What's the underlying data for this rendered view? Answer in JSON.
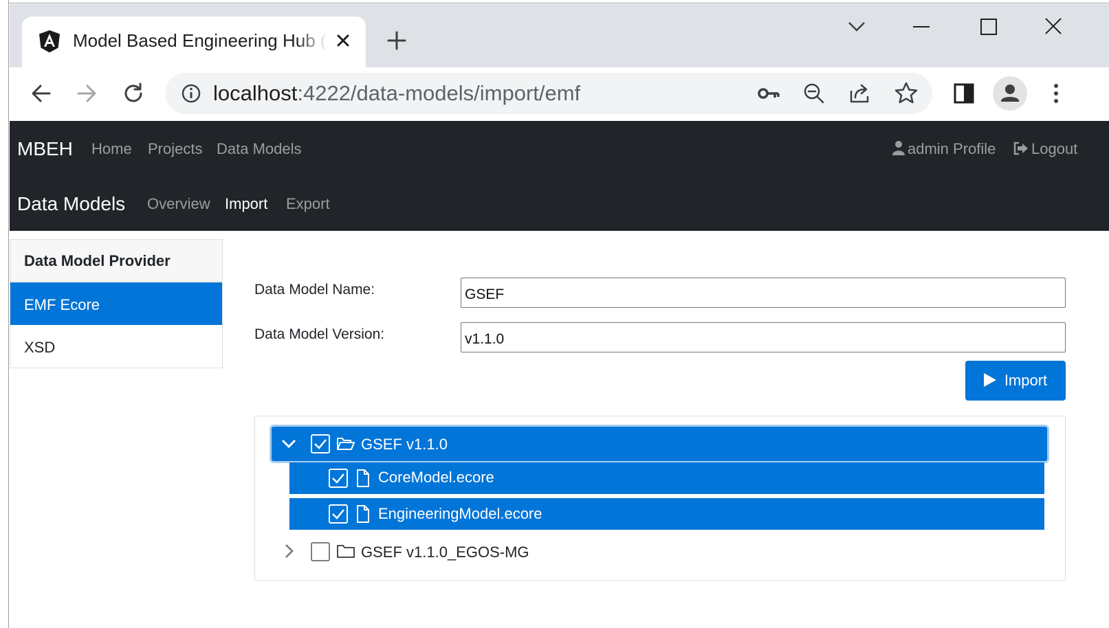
{
  "browser": {
    "tab_title": "Model Based Engineering Hub (Model Based Engineering Hub)",
    "url_host": "localhost",
    "url_path": ":4222/data-models/import/emf"
  },
  "navbar": {
    "brand": "MBEH",
    "links": [
      "Home",
      "Projects",
      "Data Models"
    ],
    "profile": "admin Profile",
    "logout": "Logout"
  },
  "subnav": {
    "title": "Data Models",
    "links": [
      "Overview",
      "Import",
      "Export"
    ],
    "active": "Import"
  },
  "provider": {
    "header": "Data Model Provider",
    "items": [
      "EMF Ecore",
      "XSD"
    ],
    "selected": "EMF Ecore"
  },
  "form": {
    "name_label": "Data Model Name:",
    "name_value": "GSEF",
    "version_label": "Data Model Version:",
    "version_value": "v1.1.0",
    "import_label": "Import"
  },
  "tree": {
    "nodes": [
      {
        "label": "GSEF v1.1.0",
        "expanded": true,
        "checked": true,
        "selected": true,
        "type": "folder-open-icon"
      },
      {
        "label": "CoreModel.ecore",
        "checked": true,
        "selected": true,
        "type": "file-icon"
      },
      {
        "label": "EngineeringModel.ecore",
        "checked": true,
        "selected": true,
        "type": "file-icon"
      },
      {
        "label": "GSEF v1.1.0_EGOS-MG",
        "expanded": false,
        "checked": false,
        "selected": false,
        "type": "folder-icon"
      }
    ]
  },
  "colors": {
    "primary": "#0275d8",
    "navbar": "#212529",
    "tabstrip": "#dee1e6"
  }
}
